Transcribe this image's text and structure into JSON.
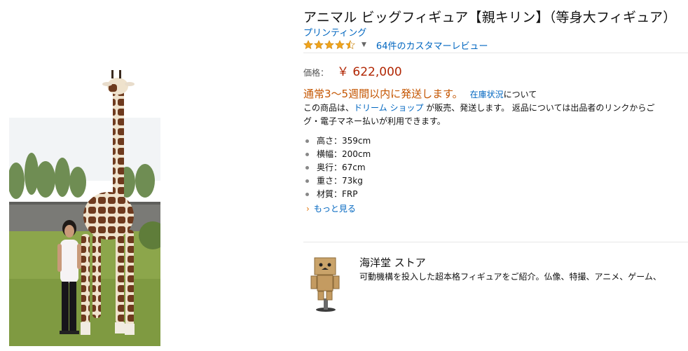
{
  "product": {
    "title": "アニマル ビッグフィギュア【親キリン】（等身大フィギュア）",
    "brand": "プリンティング",
    "rating_stars": 4.5,
    "review_count_text": "64件のカスタマーレビュー",
    "price_label": "価格：",
    "price": "￥ 622,000",
    "shipping": "通常3～5週間以内に発送します。",
    "stock_link": "在庫状況",
    "stock_suffix": "について",
    "seller_prefix": "この商品は、",
    "seller_name": "ドリーム ショップ",
    "seller_suffix": " が販売、発送します。 返品については出品者のリンクからご",
    "payment_note": "グ・電子マネー払いが利用できます。",
    "specs": [
      "高さ：359cm",
      "横幅：200cm",
      "奥行：67cm",
      "重さ：73kg",
      "材質：FRP"
    ],
    "see_more": "もっと見る"
  },
  "store": {
    "name": "海洋堂 ストア",
    "description": "可動機構を投入した超本格フィギュアをご紹介。仏像、特撮、アニメ、ゲーム、"
  },
  "colors": {
    "link": "#0066c0",
    "price": "#b12704",
    "shipping": "#c45500",
    "star": "#f0a41b"
  },
  "icons": {
    "stars": "star-icon",
    "caret": "caret-down-icon",
    "see_more": "chevron-right-icon"
  }
}
